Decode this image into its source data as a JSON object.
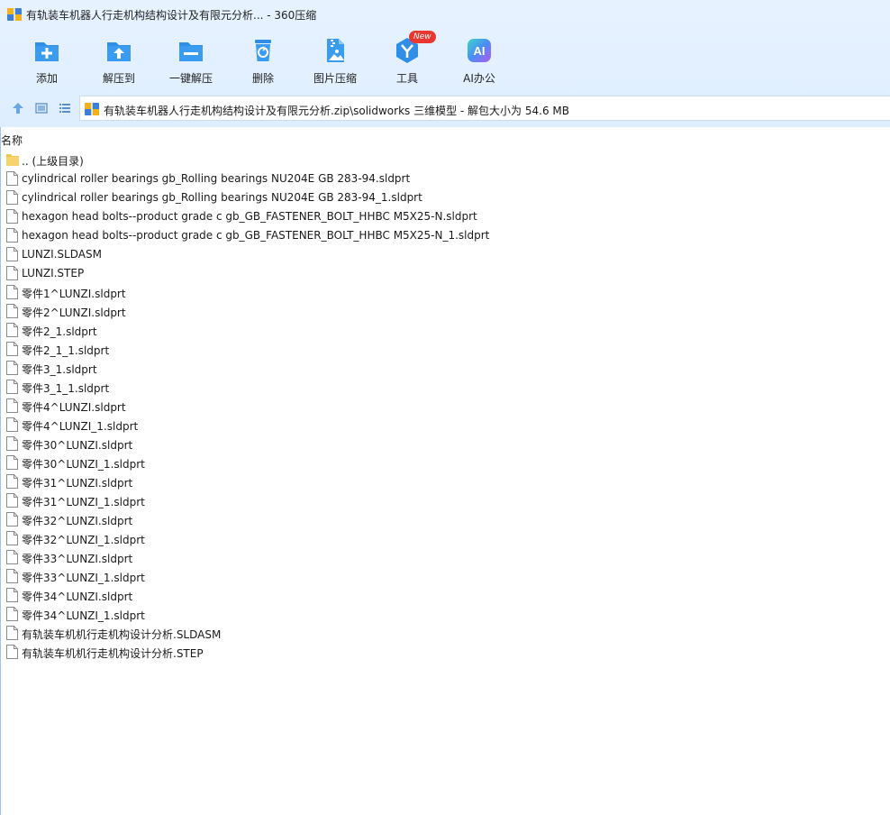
{
  "window": {
    "title": "有轨装车机器人行走机构结构设计及有限元分析... - 360压缩"
  },
  "toolbar": {
    "buttons": [
      {
        "label": "添加",
        "icon": "add-icon"
      },
      {
        "label": "解压到",
        "icon": "extract-to-icon"
      },
      {
        "label": "一键解压",
        "icon": "one-click-extract-icon"
      },
      {
        "label": "删除",
        "icon": "delete-icon"
      },
      {
        "label": "图片压缩",
        "icon": "image-compress-icon"
      },
      {
        "label": "工具",
        "icon": "tools-icon",
        "badge": "New"
      },
      {
        "label": "AI办公",
        "icon": "ai-office-icon",
        "icon_text": "AI"
      }
    ]
  },
  "nav": {
    "path": "有轨装车机器人行走机构结构设计及有限元分析.zip\\solidworks 三维模型 - 解包大小为 54.6 MB"
  },
  "list": {
    "column_name": "名称",
    "parent_dir": ".. (上级目录)",
    "files": [
      "cylindrical roller bearings gb_Rolling bearings NU204E GB 283-94.sldprt",
      "cylindrical roller bearings gb_Rolling bearings NU204E GB 283-94_1.sldprt",
      "hexagon head bolts--product grade c gb_GB_FASTENER_BOLT_HHBC M5X25-N.sldprt",
      "hexagon head bolts--product grade c gb_GB_FASTENER_BOLT_HHBC M5X25-N_1.sldprt",
      "LUNZI.SLDASM",
      "LUNZI.STEP",
      "零件1^LUNZI.sldprt",
      "零件2^LUNZI.sldprt",
      "零件2_1.sldprt",
      "零件2_1_1.sldprt",
      "零件3_1.sldprt",
      "零件3_1_1.sldprt",
      "零件4^LUNZI.sldprt",
      "零件4^LUNZI_1.sldprt",
      "零件30^LUNZI.sldprt",
      "零件30^LUNZI_1.sldprt",
      "零件31^LUNZI.sldprt",
      "零件31^LUNZI_1.sldprt",
      "零件32^LUNZI.sldprt",
      "零件32^LUNZI_1.sldprt",
      "零件33^LUNZI.sldprt",
      "零件33^LUNZI_1.sldprt",
      "零件34^LUNZI.sldprt",
      "零件34^LUNZI_1.sldprt",
      "有轨装车机机行走机构设计分析.SLDASM",
      "有轨装车机机行走机构设计分析.STEP"
    ]
  },
  "colors": {
    "toolbar_bg": "#deeeff",
    "icon_blue": "#2f8fe6",
    "badge_red": "#e8382f",
    "folder_yellow": "#f7d36b"
  }
}
